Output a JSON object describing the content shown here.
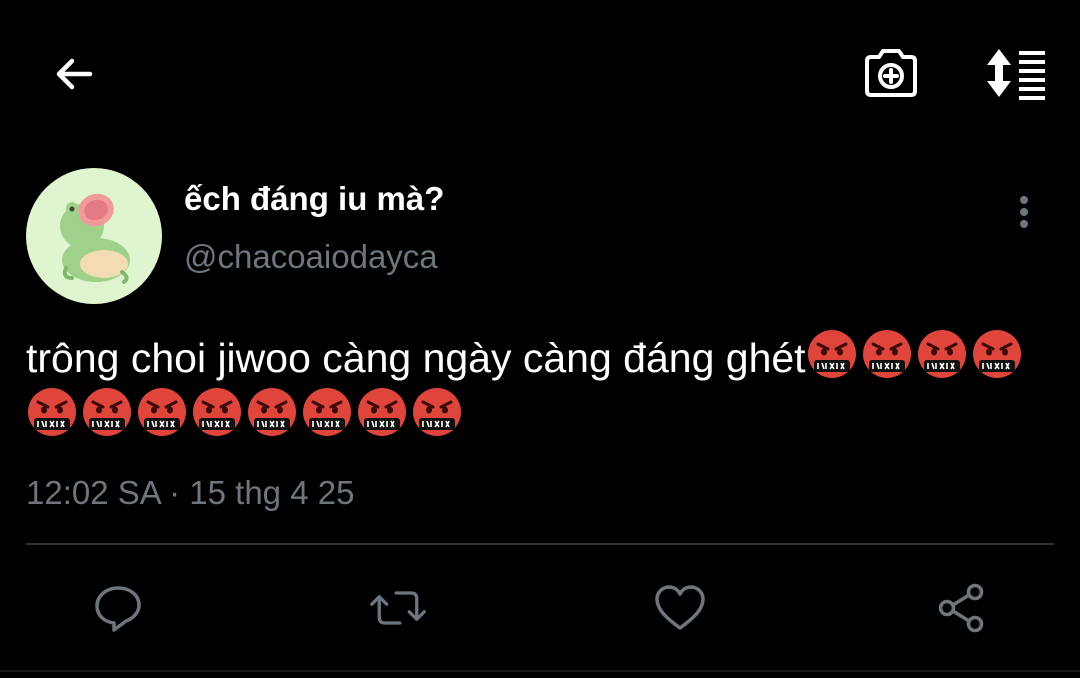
{
  "toolbar": {
    "back_icon": "arrow-left-icon",
    "camera_icon": "camera-plus-icon",
    "sort_icon": "sort-list-icon"
  },
  "tweet": {
    "display_name": "ếch đáng iu mà?",
    "handle": "@chacoaiodayca",
    "text": "trông choi jiwoo càng ngày càng đáng ghét",
    "emoji_name": "face-with-symbols-on-mouth",
    "emoji_count": 12,
    "timestamp": "12:02 SA · 15 thg 4 25",
    "more_icon": "more-vertical-icon"
  },
  "actions": {
    "reply_icon": "reply-icon",
    "retweet_icon": "retweet-icon",
    "like_icon": "heart-icon",
    "share_icon": "share-icon"
  },
  "colors": {
    "background": "#000000",
    "text": "#ffffff",
    "secondary": "#6e767d",
    "divider": "#2f3336",
    "avatar_bg": "#dff5cf",
    "emoji_red": "#e0453b"
  }
}
